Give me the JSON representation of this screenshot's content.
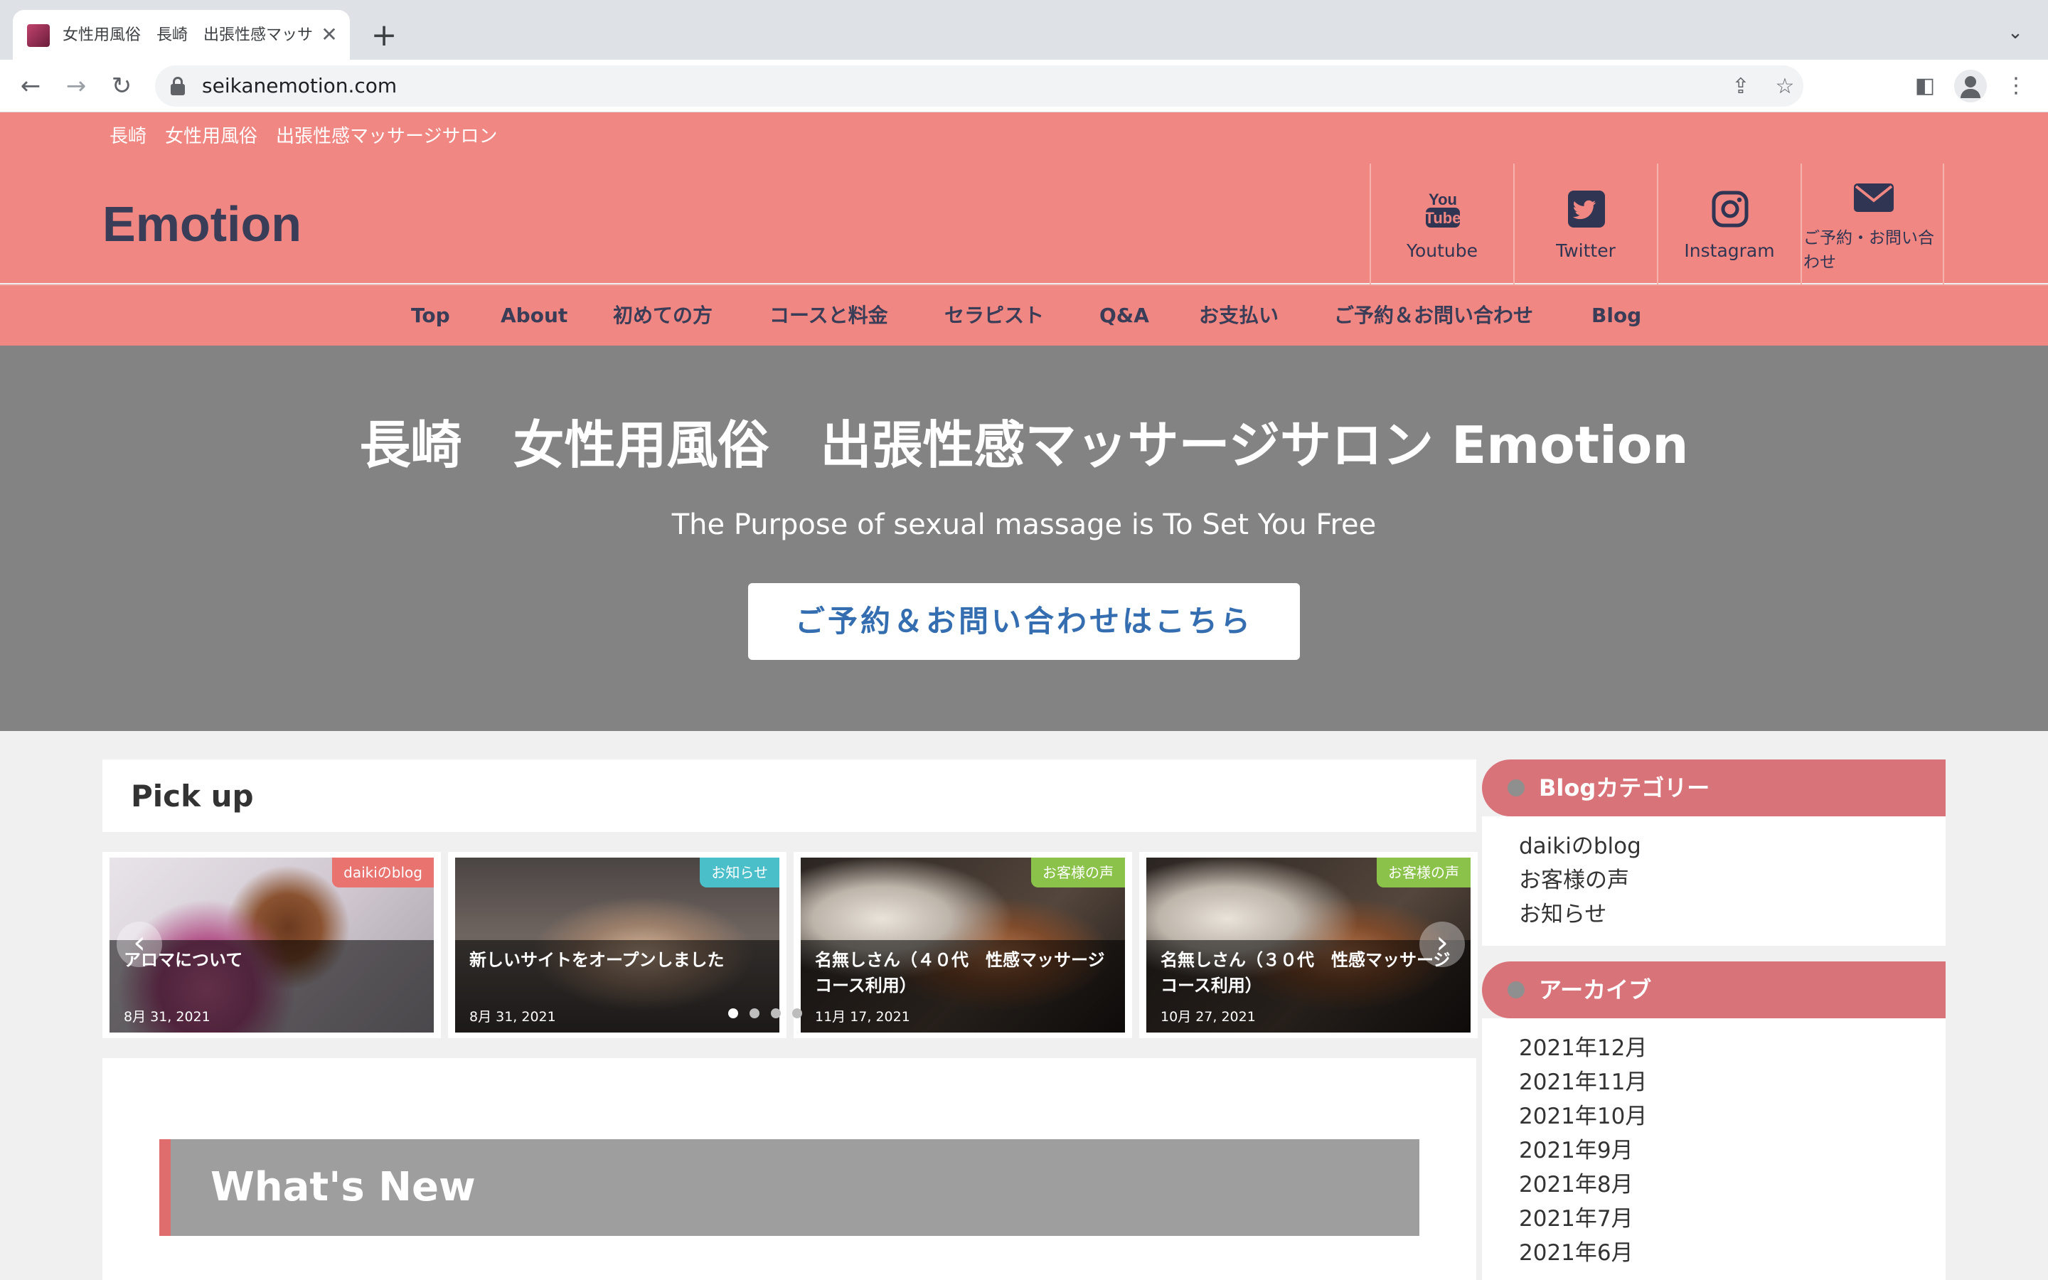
{
  "browser": {
    "tab_title": "女性用風俗　長崎　出張性感マッサ",
    "url": "seikanemotion.com"
  },
  "site": {
    "tagline": "長崎　女性用風俗　出張性感マッサージサロン",
    "logo": "Emotion",
    "sns": [
      {
        "label": "Youtube"
      },
      {
        "label": "Twitter"
      },
      {
        "label": "Instagram"
      },
      {
        "label": "ご予約・お問い合わせ"
      }
    ],
    "nav": [
      "Top",
      "About",
      "初めての方",
      "コースと料金",
      "セラピスト",
      "Q&A",
      "お支払い",
      "ご予約＆お問い合わせ",
      "Blog"
    ]
  },
  "hero": {
    "title": "長崎　女性用風俗　出張性感マッサージサロン Emotion",
    "subtitle": "The Purpose of sexual massage is To Set You Free",
    "cta": "ご予約＆お問い合わせはこちら"
  },
  "pickup": {
    "heading": "Pick up",
    "cards": [
      {
        "tag": "daikiのblog",
        "title": "アロマについて",
        "date": "8月 31, 2021",
        "tag_color": "#e8736f"
      },
      {
        "tag": "お知らせ",
        "title": "新しいサイトをオープンしました",
        "date": "8月 31, 2021",
        "tag_color": "#4bbfc9"
      },
      {
        "tag": "お客様の声",
        "title": "名無しさん（４０代　性感マッサージコース利用）",
        "date": "11月 17, 2021",
        "tag_color": "#8bc34a"
      },
      {
        "tag": "お客様の声",
        "title": "名無しさん（３０代　性感マッサージコース利用）",
        "date": "10月 27, 2021",
        "tag_color": "#8bc34a"
      }
    ]
  },
  "whats_new": {
    "heading": "What's New"
  },
  "sidebar": {
    "categories": {
      "title": "Blogカテゴリー",
      "items": [
        "daikiのblog",
        "お客様の声",
        "お知らせ"
      ]
    },
    "archive": {
      "title": "アーカイブ",
      "items": [
        "2021年12月",
        "2021年11月",
        "2021年10月",
        "2021年9月",
        "2021年8月",
        "2021年7月",
        "2021年6月"
      ]
    }
  },
  "colors": {
    "header_bg": "#f08782",
    "hero_bg": "#838383",
    "brand_text": "#3a3d57",
    "cta_text": "#356eb0",
    "widget_head": "#d9737a"
  }
}
